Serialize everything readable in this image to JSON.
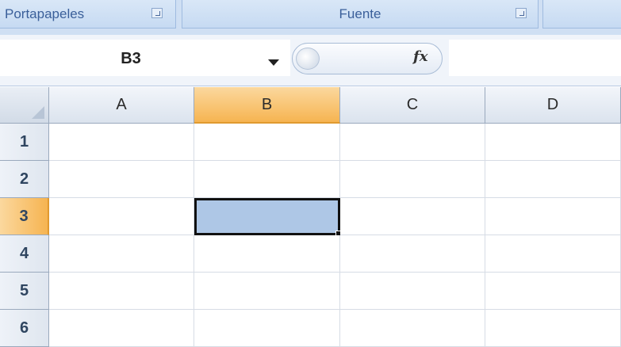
{
  "ribbon": {
    "groups": [
      {
        "label": "Portapapeles"
      },
      {
        "label": "Fuente"
      }
    ]
  },
  "formula_bar": {
    "name_box_value": "B3",
    "fx_label": "fx",
    "formula_value": ""
  },
  "sheet": {
    "columns": [
      "A",
      "B",
      "C",
      "D"
    ],
    "rows": [
      "1",
      "2",
      "3",
      "4",
      "5",
      "6"
    ],
    "active_cell": "B3",
    "colors": {
      "selected_fill": "#aec7e6",
      "active_header": "#f6b451",
      "ribbon": "#cfdff3"
    }
  }
}
